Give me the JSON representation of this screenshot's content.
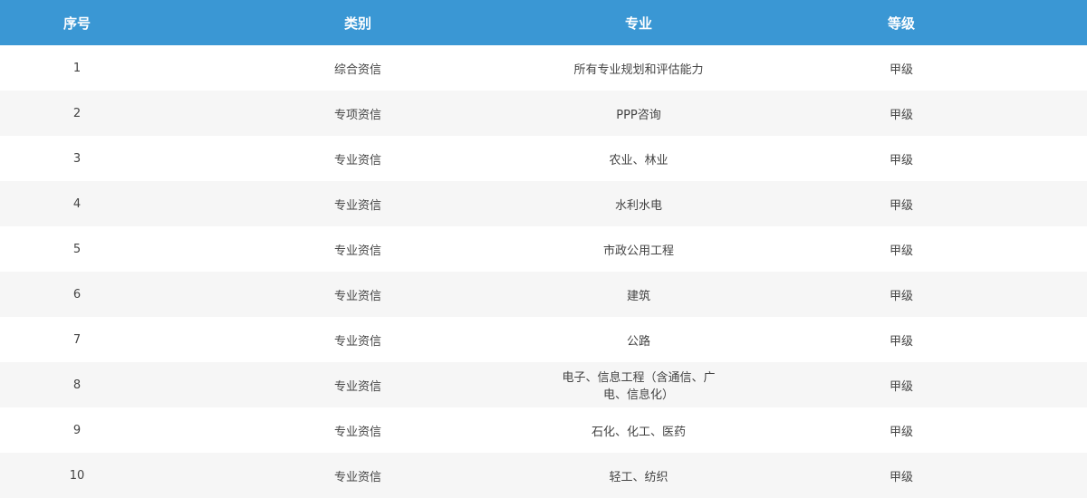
{
  "table": {
    "headers": [
      "序号",
      "类别",
      "专业",
      "等级"
    ],
    "rows": [
      {
        "no": "1",
        "category": "综合资信",
        "major": "所有专业规划和评估能力",
        "level": "甲级"
      },
      {
        "no": "2",
        "category": "专项资信",
        "major": "PPP咨询",
        "level": "甲级"
      },
      {
        "no": "3",
        "category": "专业资信",
        "major": "农业、林业",
        "level": "甲级"
      },
      {
        "no": "4",
        "category": "专业资信",
        "major": "水利水电",
        "level": "甲级"
      },
      {
        "no": "5",
        "category": "专业资信",
        "major": "市政公用工程",
        "level": "甲级"
      },
      {
        "no": "6",
        "category": "专业资信",
        "major": "建筑",
        "level": "甲级"
      },
      {
        "no": "7",
        "category": "专业资信",
        "major": "公路",
        "level": "甲级"
      },
      {
        "no": "8",
        "category": "专业资信",
        "major": "电子、信息工程（含通信、广电、信息化）",
        "level": "甲级"
      },
      {
        "no": "9",
        "category": "专业资信",
        "major": "石化、化工、医药",
        "level": "甲级"
      },
      {
        "no": "10",
        "category": "专业资信",
        "major": "轻工、纺织",
        "level": "甲级"
      }
    ]
  },
  "colors": {
    "header_bg": "#3a97d4",
    "header_text": "#ffffff",
    "row_alt_bg": "#f6f6f6",
    "cell_text": "#444444"
  }
}
